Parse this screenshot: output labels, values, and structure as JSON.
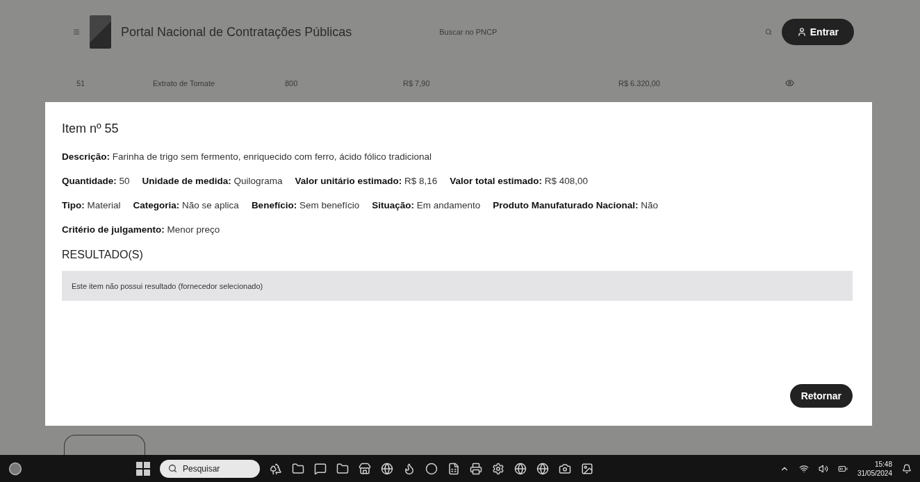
{
  "header": {
    "title": "Portal Nacional de Contratações Públicas",
    "search_placeholder": "Buscar no PNCP",
    "login_button": "Entrar"
  },
  "background_row": {
    "cells": [
      "51",
      "Extrato de Tomate",
      "800",
      "R$ 7,90",
      "R$ 6.320,00"
    ]
  },
  "modal": {
    "title": "Item nº 55",
    "lines": [
      [
        {
          "label": "Descrição:",
          "value": "Farinha de trigo sem fermento, enriquecido com ferro, ácido fólico tradicional"
        }
      ],
      [
        {
          "label": "Quantidade:",
          "value": "50"
        },
        {
          "label": "Unidade de medida:",
          "value": "Quilograma"
        },
        {
          "label": "Valor unitário estimado:",
          "value": "R$ 8,16"
        },
        {
          "label": "Valor total estimado:",
          "value": "R$ 408,00"
        }
      ],
      [
        {
          "label": "Tipo:",
          "value": "Material"
        },
        {
          "label": "Categoria:",
          "value": "Não se aplica"
        },
        {
          "label": "Benefício:",
          "value": "Sem benefício"
        },
        {
          "label": "Situação:",
          "value": "Em andamento"
        },
        {
          "label": "Produto Manufaturado Nacional:",
          "value": "Não"
        }
      ],
      [
        {
          "label": "Critério de julgamento:",
          "value": "Menor preço"
        }
      ]
    ],
    "results_heading": "RESULTADO(S)",
    "results_message": "Este item não possui resultado (fornecedor selecionado)",
    "return_button": "Retornar"
  },
  "taskbar": {
    "search_placeholder": "Pesquisar",
    "time": "15:48",
    "date": "31/05/2024"
  }
}
